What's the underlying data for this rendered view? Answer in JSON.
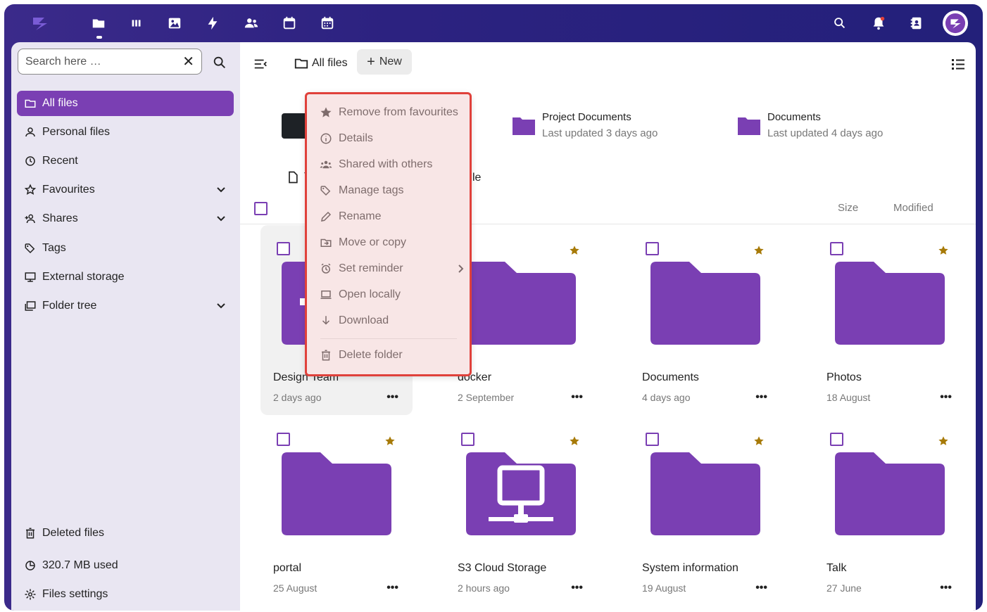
{
  "topbar": {
    "apps": [
      "logo-icon",
      "files-icon",
      "activity-icon",
      "photos-icon",
      "flash-icon",
      "contacts-icon",
      "calendar-icon",
      "calendar-grid-icon"
    ],
    "right_icons": [
      "search-icon",
      "notifications-icon",
      "contacts-menu-icon"
    ]
  },
  "sidebar": {
    "search_placeholder": "Search here …",
    "items": [
      {
        "label": "All files",
        "icon": "folder-icon",
        "active": true
      },
      {
        "label": "Personal files",
        "icon": "person-icon"
      },
      {
        "label": "Recent",
        "icon": "history-icon"
      },
      {
        "label": "Favourites",
        "icon": "star-icon",
        "expandable": true
      },
      {
        "label": "Shares",
        "icon": "share-icon",
        "expandable": true
      },
      {
        "label": "Tags",
        "icon": "tag-icon"
      },
      {
        "label": "External storage",
        "icon": "monitor-icon"
      },
      {
        "label": "Folder tree",
        "icon": "folder-tree-icon",
        "expandable": true
      }
    ],
    "bottom": {
      "deleted": "Deleted files",
      "quota": "320.7 MB used",
      "settings": "Files settings"
    }
  },
  "toolbar": {
    "breadcrumb": "All files",
    "new_label": "New"
  },
  "recent": [
    {
      "title": "Project Documents",
      "subtitle": "Last updated 3 days ago"
    },
    {
      "title": "Documents",
      "subtitle": "Last updated 4 days ago"
    }
  ],
  "partial_labels": {
    "template_prefix": "T",
    "partial_suffix": "le"
  },
  "columns": {
    "size": "Size",
    "modified": "Modified"
  },
  "files": [
    {
      "name": "Design Team",
      "date": "2 days ago",
      "favorite": false
    },
    {
      "name": "docker",
      "date": "2 September",
      "favorite": true
    },
    {
      "name": "Documents",
      "date": "4 days ago",
      "favorite": true
    },
    {
      "name": "Photos",
      "date": "18 August",
      "favorite": true
    },
    {
      "name": "portal",
      "date": "25 August",
      "favorite": true
    },
    {
      "name": "S3 Cloud Storage",
      "date": "2 hours ago",
      "favorite": true
    },
    {
      "name": "System information",
      "date": "19 August",
      "favorite": true
    },
    {
      "name": "Talk",
      "date": "27 June",
      "favorite": true
    }
  ],
  "context_menu": {
    "items": [
      {
        "label": "Remove from favourites",
        "icon": "star-icon"
      },
      {
        "label": "Details",
        "icon": "info-icon"
      },
      {
        "label": "Shared with others",
        "icon": "people-icon"
      },
      {
        "label": "Manage tags",
        "icon": "tag-icon"
      },
      {
        "label": "Rename",
        "icon": "pencil-icon"
      },
      {
        "label": "Move or copy",
        "icon": "move-icon"
      },
      {
        "label": "Set reminder",
        "icon": "alarm-icon"
      },
      {
        "label": "Open locally",
        "icon": "laptop-icon"
      },
      {
        "label": "Download",
        "icon": "download-icon"
      },
      {
        "label": "Delete folder",
        "icon": "trash-icon"
      }
    ]
  },
  "colors": {
    "accent": "#7a3fb3",
    "topbar": "#2c2280",
    "highlight": "#e0413b"
  }
}
